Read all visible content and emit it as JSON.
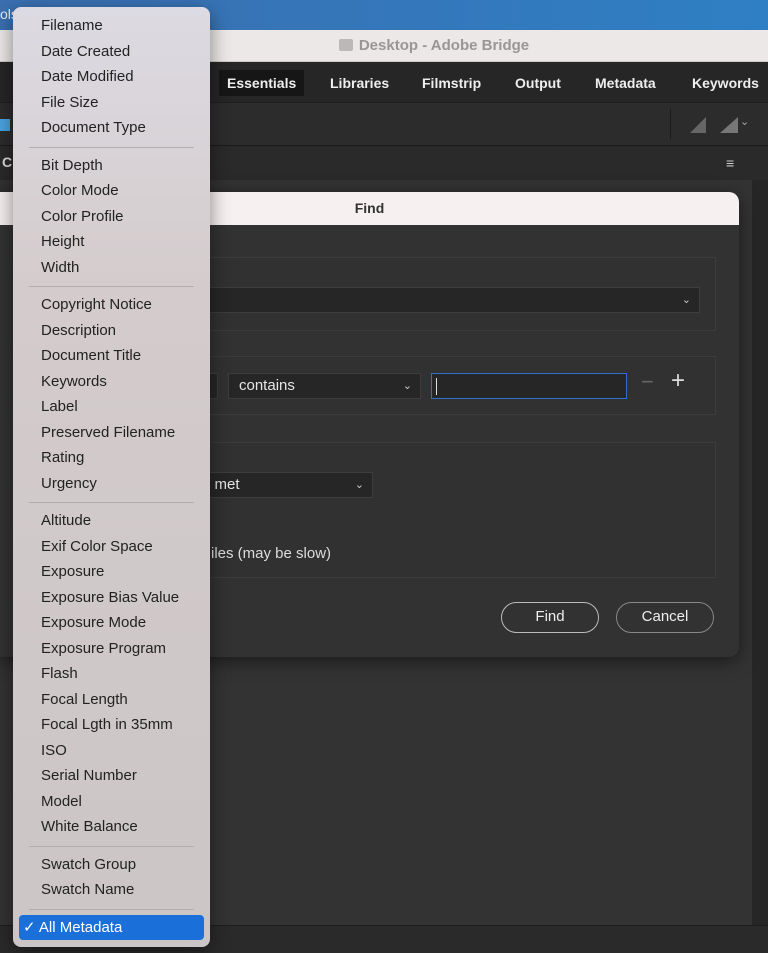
{
  "desktop": {
    "partial_text": "ols"
  },
  "window": {
    "title": "Desktop - Adobe Bridge"
  },
  "workspaces": [
    {
      "label": "Essentials",
      "active": true
    },
    {
      "label": "Libraries"
    },
    {
      "label": "Filmstrip"
    },
    {
      "label": "Output"
    },
    {
      "label": "Metadata"
    },
    {
      "label": "Keywords"
    }
  ],
  "panel": {
    "partial_label": "C"
  },
  "dialog": {
    "title": "Find",
    "criteria_operator": "contains",
    "criteria_value": "",
    "match_partial": "e met",
    "option_partial": "iles (may be slow)",
    "find_label": "Find",
    "cancel_label": "Cancel",
    "remove_label": "−",
    "add_label": "+"
  },
  "menu": {
    "groups": [
      [
        "Filename",
        "Date Created",
        "Date Modified",
        "File Size",
        "Document Type"
      ],
      [
        "Bit Depth",
        "Color Mode",
        "Color Profile",
        "Height",
        "Width"
      ],
      [
        "Copyright Notice",
        "Description",
        "Document Title",
        "Keywords",
        "Label",
        "Preserved Filename",
        "Rating",
        "Urgency"
      ],
      [
        "Altitude",
        "Exif Color Space",
        "Exposure",
        "Exposure Bias Value",
        "Exposure Mode",
        "Exposure Program",
        "Flash",
        "Focal Length",
        "Focal Lgth in 35mm",
        "ISO",
        "Serial Number",
        "Model",
        "White Balance"
      ],
      [
        "Swatch Group",
        "Swatch Name"
      ]
    ],
    "selected": "All Metadata",
    "check": "✓"
  },
  "colors": {
    "accent": "#1a6fd9",
    "focus": "#2f6fd0"
  }
}
